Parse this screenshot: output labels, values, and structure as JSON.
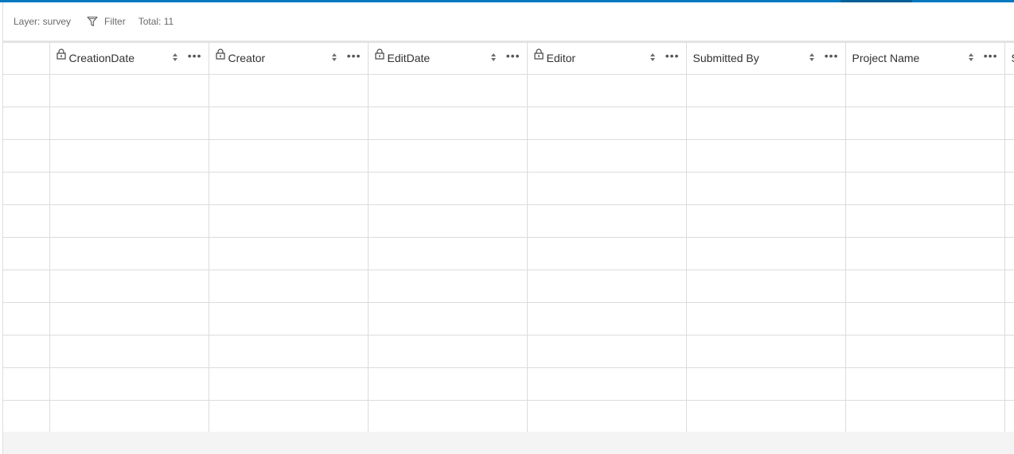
{
  "toolbar": {
    "layer_label": "Layer: survey",
    "filter_label": "Filter",
    "total_label": "Total: 11"
  },
  "table": {
    "columns": [
      {
        "label": "CreationDate",
        "locked": true
      },
      {
        "label": "Creator",
        "locked": true
      },
      {
        "label": "EditDate",
        "locked": true
      },
      {
        "label": "Editor",
        "locked": true
      },
      {
        "label": "Submitted By",
        "locked": false
      },
      {
        "label": "Project Name",
        "locked": false
      },
      {
        "label": "S",
        "locked": false
      }
    ],
    "row_count": 11
  },
  "colors": {
    "accent": "#0079c1",
    "accent_dark": "#005e95",
    "grid_line": "#dcdcdc",
    "footer_bg": "#f4f4f4"
  },
  "icons": {
    "filter": "filter-icon",
    "lock": "lock-icon",
    "sort": "sort-icon",
    "more": "more-options-icon"
  }
}
